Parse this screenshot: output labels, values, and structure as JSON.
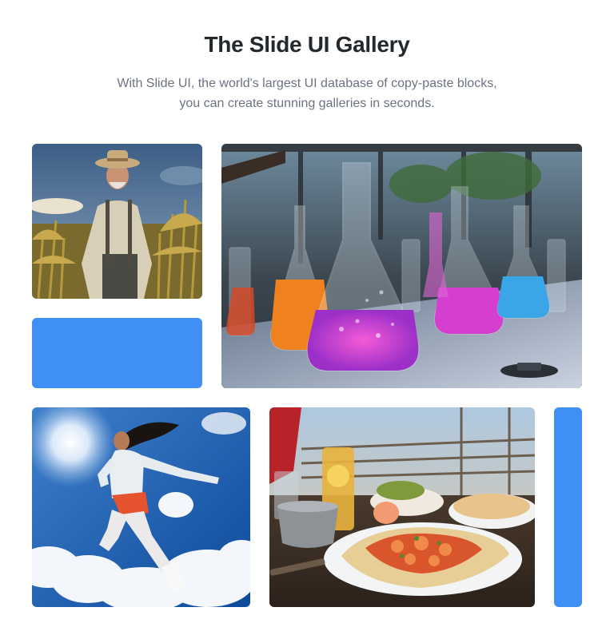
{
  "header": {
    "title": "The Slide UI Gallery",
    "subtitle_line1": "With Slide UI, the world's largest UI database of copy-paste blocks,",
    "subtitle_line2": "you can create stunning galleries in seconds."
  },
  "gallery": {
    "accent_color": "#3f8ff5",
    "tiles": [
      {
        "kind": "image",
        "icon": "farmer-photo"
      },
      {
        "kind": "color-block"
      },
      {
        "kind": "image",
        "icon": "lab-flasks-photo"
      },
      {
        "kind": "image",
        "icon": "jumping-woman-photo"
      },
      {
        "kind": "image",
        "icon": "food-plate-photo"
      },
      {
        "kind": "color-block"
      }
    ]
  }
}
